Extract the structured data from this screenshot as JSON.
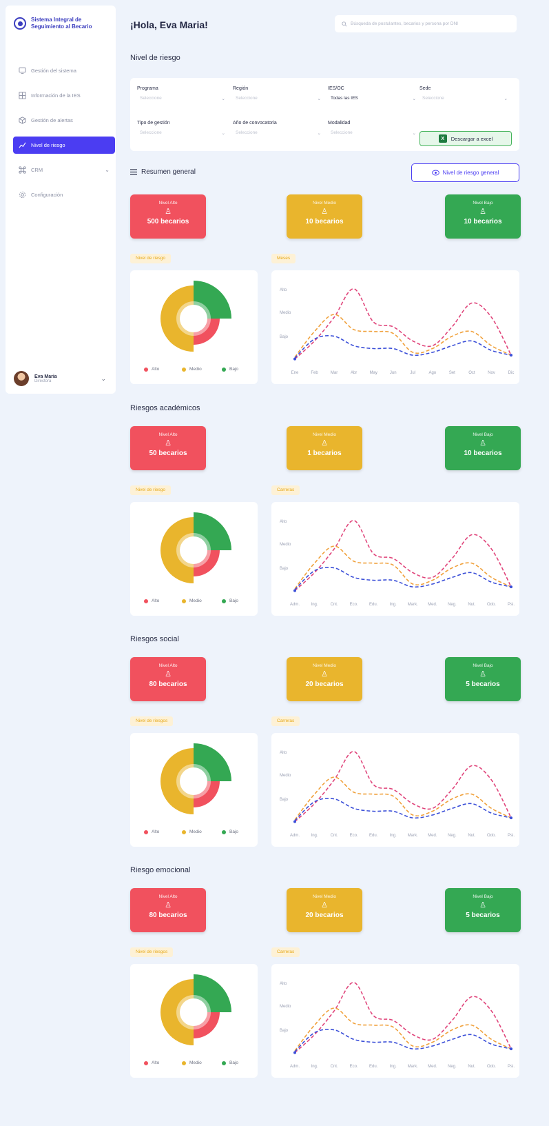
{
  "brand": {
    "line1": "Sistema Integral de",
    "line2": "Seguimiento al Becario"
  },
  "nav": [
    {
      "label": "Gestión del sistema",
      "icon": "monitor-icon",
      "active": false
    },
    {
      "label": "Información de la IES",
      "icon": "building-icon",
      "active": false
    },
    {
      "label": "Gestión de alertas",
      "icon": "box-icon",
      "active": false
    },
    {
      "label": "Nivel de riesgo",
      "icon": "chart-line-icon",
      "active": true
    },
    {
      "label": "CRM",
      "icon": "command-icon",
      "active": false
    },
    {
      "label": "Configuración",
      "icon": "gear-icon",
      "active": false
    }
  ],
  "user": {
    "name": "Eva Maria",
    "role": "Directora"
  },
  "greeting": "¡Hola, Eva Maria!",
  "search": {
    "placeholder": "Búsqueda de postulantes, becarios y persona por DNI"
  },
  "page_title": "Nivel de riesgo",
  "filters": [
    {
      "label": "Programa",
      "value": "Seleccione",
      "set": false
    },
    {
      "label": "Región",
      "value": "Seleccione",
      "set": false
    },
    {
      "label": "IES/OC",
      "value": "Todas las IES",
      "set": true
    },
    {
      "label": "Sede",
      "value": "Seleccione",
      "set": false
    },
    {
      "label": "Tipo de gestión",
      "value": "Seleccione",
      "set": false
    },
    {
      "label": "Año de convocatoria",
      "value": "Seleccione",
      "set": false
    },
    {
      "label": "Modalidad",
      "value": "Seleccione",
      "set": false
    }
  ],
  "excel_button": "Descargar a excel",
  "resumen_title": "Resumen general",
  "riesgo_general_button": "Nivel de riesgo general",
  "colors": {
    "alto": "#f1515e",
    "medio": "#e9b52d",
    "bajo": "#34a853",
    "accent": "#4b3df2"
  },
  "legend": {
    "alto": "Alto",
    "medio": "Medio",
    "bajo": "Bajo"
  },
  "y_labels": [
    "Alto",
    "Medio",
    "Bajo"
  ],
  "sections": [
    {
      "title": "",
      "cards": [
        {
          "label": "Nivel Alto",
          "value": "500 becarios"
        },
        {
          "label": "Nivel Medio",
          "value": "10 becarios"
        },
        {
          "label": "Nivel Bajo",
          "value": "10 becarios"
        }
      ],
      "tag_left": "Nivel de riesgo",
      "tag_right": "Meses",
      "x_labels": [
        "Ene",
        "Feb",
        "Mar",
        "Abr",
        "May",
        "Jun",
        "Jul",
        "Ago",
        "Set",
        "Oct",
        "Nov",
        "Dic"
      ]
    },
    {
      "title": "Riesgos académicos",
      "cards": [
        {
          "label": "Nivel Alto",
          "value": "50 becarios"
        },
        {
          "label": "Nivel Medio",
          "value": "1 becarios"
        },
        {
          "label": "Nivel Bajo",
          "value": "10 becarios"
        }
      ],
      "tag_left": "Nivel de riesgo",
      "tag_right": "Carreras",
      "x_labels": [
        "Adm.",
        "Ing.",
        "Cnt.",
        "Eco.",
        "Edu.",
        "Ing.",
        "Mark.",
        "Med.",
        "Neg.",
        "Nut.",
        "Odo.",
        "Psi."
      ]
    },
    {
      "title": "Riesgos social",
      "cards": [
        {
          "label": "Nivel Alto",
          "value": "80 becarios"
        },
        {
          "label": "Nivel Medio",
          "value": "20 becarios"
        },
        {
          "label": "Nivel Bajo",
          "value": "5 becarios"
        }
      ],
      "tag_left": "Nivel de riesgos",
      "tag_right": "Carreras",
      "x_labels": [
        "Adm.",
        "Ing.",
        "Cnt.",
        "Eco.",
        "Edu.",
        "Ing.",
        "Mark.",
        "Med.",
        "Neg.",
        "Nut.",
        "Odo.",
        "Psi."
      ]
    },
    {
      "title": "Riesgo emocional",
      "cards": [
        {
          "label": "Nivel Alto",
          "value": "80 becarios"
        },
        {
          "label": "Nivel Medio",
          "value": "20 becarios"
        },
        {
          "label": "Nivel Bajo",
          "value": "5 becarios"
        }
      ],
      "tag_left": "Nivel de riesgos",
      "tag_right": "Carreras",
      "x_labels": [
        "Adm.",
        "Ing.",
        "Cnt.",
        "Eco.",
        "Edu.",
        "Ing.",
        "Mark.",
        "Med.",
        "Neg.",
        "Nut.",
        "Odo.",
        "Psi."
      ]
    }
  ],
  "chart_data": {
    "type": "line",
    "y_tick_labels": [
      "Alto",
      "Medio",
      "Bajo"
    ],
    "series": [
      {
        "color": "#e0457b",
        "values": [
          1,
          20,
          45,
          75,
          40,
          35,
          20,
          15,
          35,
          60,
          45,
          5
        ]
      },
      {
        "color": "#f0a13c",
        "values": [
          3,
          30,
          48,
          32,
          30,
          28,
          8,
          12,
          25,
          30,
          15,
          5
        ]
      },
      {
        "color": "#3b4fd8",
        "values": [
          2,
          22,
          25,
          15,
          12,
          12,
          5,
          8,
          15,
          20,
          10,
          5
        ]
      }
    ],
    "donut": [
      {
        "name": "Alto",
        "value": 25,
        "color": "#f1515e"
      },
      {
        "name": "Medio",
        "value": 50,
        "color": "#e9b52d"
      },
      {
        "name": "Bajo",
        "value": 25,
        "color": "#34a853"
      }
    ]
  }
}
